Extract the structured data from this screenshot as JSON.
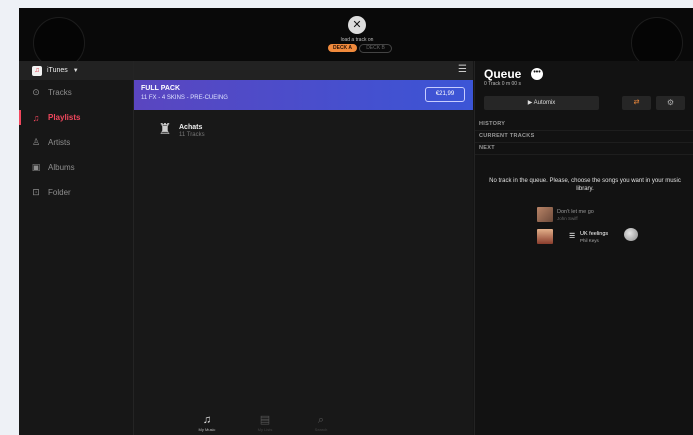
{
  "topbar": {
    "close_icon": "close-icon",
    "load_text": "load a track on",
    "deck_a": "DECK A",
    "deck_b": "DECK B"
  },
  "sidebar": {
    "source": "iTunes",
    "items": [
      {
        "label": "Tracks",
        "icon": "⊙",
        "active": false
      },
      {
        "label": "Playlists",
        "icon": "♫",
        "active": true
      },
      {
        "label": "Artists",
        "icon": "♙",
        "active": false
      },
      {
        "label": "Albums",
        "icon": "▣",
        "active": false
      },
      {
        "label": "Folder",
        "icon": "⊡",
        "active": false
      }
    ]
  },
  "center": {
    "promo": {
      "title": "FULL PACK",
      "subtitle": "11 FX - 4 SKINS - PRE-CUEING",
      "price": "€21,99"
    },
    "playlist": {
      "name": "Achats",
      "count": "11 Tracks"
    }
  },
  "bottom_nav": [
    {
      "label": "My Music",
      "icon": "♫",
      "active": true
    },
    {
      "label": "My Lists",
      "icon": "▤",
      "active": false
    },
    {
      "label": "Search",
      "icon": "⌕",
      "active": false
    }
  ],
  "queue": {
    "title": "Queue",
    "more": "•••",
    "summary": "0 Track   0 m 00 s",
    "automix": "▶  Automix",
    "shuffle": "⇄",
    "settings": "⚙",
    "sections": [
      "HISTORY",
      "CURRENT TRACKS",
      "NEXT"
    ],
    "empty_message": "No track in the queue. Please, choose the songs you want in your music library.",
    "suggestions": [
      {
        "title": "Don't let me go",
        "artist": "John Swiff"
      },
      {
        "title": "UK feelings",
        "artist": "Phil Keys"
      }
    ]
  },
  "colors": {
    "accent": "#f0475d",
    "deck_a": "#f08a3c",
    "promo_start": "#5a46c0",
    "promo_end": "#3b55d6"
  }
}
